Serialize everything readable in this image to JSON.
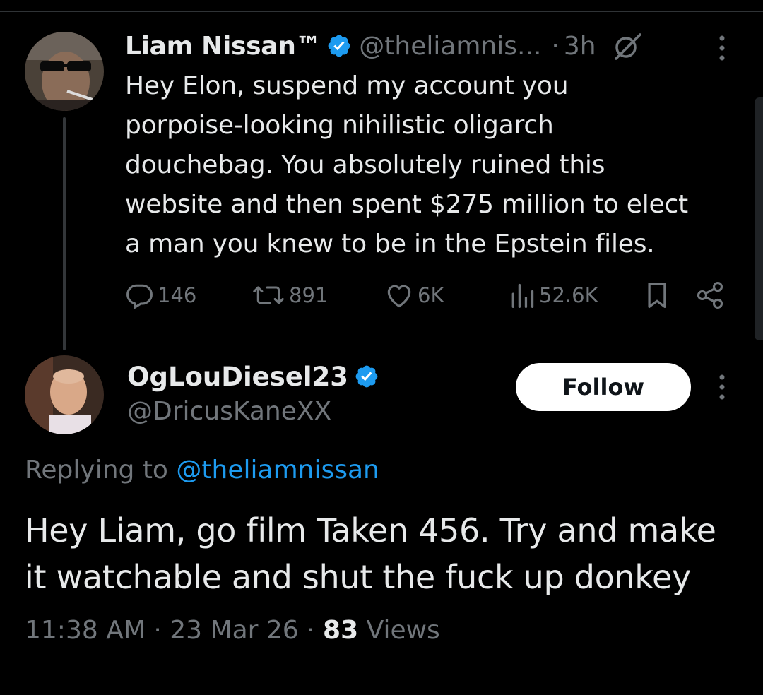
{
  "colors": {
    "background": "#000000",
    "primary_text": "#e7e9ea",
    "secondary_text": "#71767b",
    "accent_blue": "#1d9bf0",
    "follow_button_bg": "#ffffff"
  },
  "original_tweet": {
    "display_name": "Liam Nissan™",
    "verified": true,
    "handle": "@theliamnis...",
    "separator": "·",
    "time_ago": "3h",
    "grok_icon": "grok-icon",
    "text_lines": [
      "Hey Elon, suspend my account you",
      "porpoise-looking nihilistic oligarch",
      "douchebag. You absolutely ruined this",
      "website and then spent $275 million to elect",
      "a man you knew to be in the Epstein files."
    ],
    "stats": {
      "replies": "146",
      "retweets": "891",
      "likes": "6K",
      "views": "52.6K"
    },
    "icons": [
      "reply-icon",
      "retweet-icon",
      "like-icon",
      "views-icon",
      "bookmark-icon",
      "share-icon"
    ]
  },
  "reply_tweet": {
    "display_name": "OgLouDiesel23",
    "verified": true,
    "handle": "@DricusKaneXX",
    "follow_label": "Follow",
    "replying_to_label": "Replying to",
    "replying_to_handle": "@theliamnissan",
    "text_lines": [
      "Hey Liam, go film Taken 456. Try and make",
      "it watchable and shut the fuck up donkey"
    ],
    "time": "11:38 AM",
    "date": "23 Mar 26",
    "meta_separator": "·",
    "views_count": "83",
    "views_label": "Views"
  }
}
